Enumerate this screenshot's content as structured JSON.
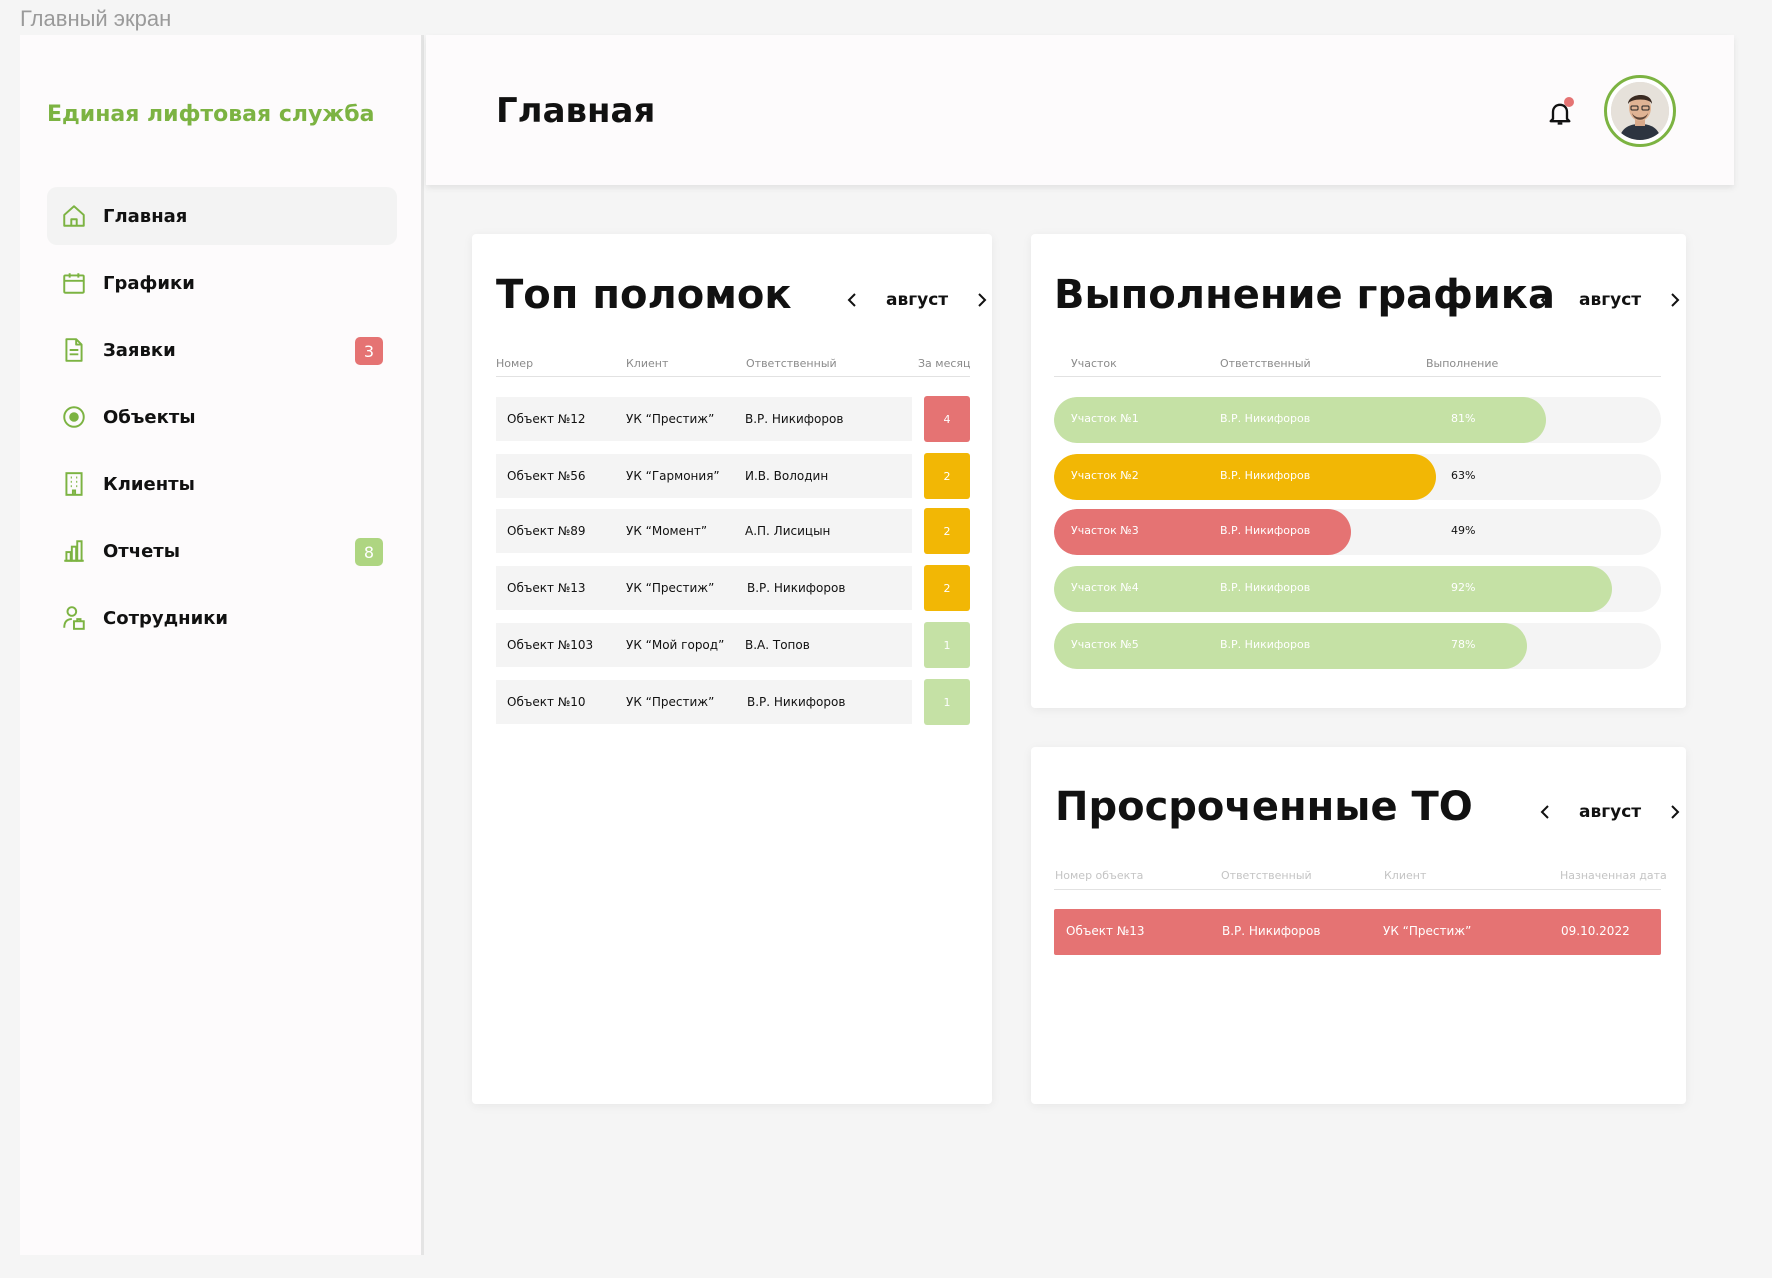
{
  "frame_label": "Главный экран",
  "brand": "Единая лифтовая служба",
  "nav": [
    {
      "label": "Главная",
      "icon": "home-icon",
      "active": true,
      "badge": ""
    },
    {
      "label": "Графики",
      "icon": "calendar-icon",
      "active": false,
      "badge": ""
    },
    {
      "label": "Заявки",
      "icon": "document-icon",
      "active": false,
      "badge": "3",
      "badge_color": "#e57373"
    },
    {
      "label": "Объекты",
      "icon": "target-icon",
      "active": false,
      "badge": ""
    },
    {
      "label": "Клиенты",
      "icon": "building-icon",
      "active": false,
      "badge": ""
    },
    {
      "label": "Отчеты",
      "icon": "bar-chart-icon",
      "active": false,
      "badge": "8",
      "badge_color": "#aed581"
    },
    {
      "label": "Сотрудники",
      "icon": "employee-icon",
      "active": false,
      "badge": ""
    }
  ],
  "header": {
    "title": "Главная"
  },
  "colors": {
    "green": "#7cb342",
    "light_green": "#c5e1a5",
    "yellow": "#f2b705",
    "red": "#e57373"
  },
  "breakdowns": {
    "title": "Топ поломок",
    "month": "август",
    "columns": [
      "Номер",
      "Клиент",
      "Ответственный",
      "За месяц"
    ],
    "rows": [
      {
        "number": "Объект №12",
        "client": "УК “Престиж”",
        "responsible": "В.Р. Никифоров",
        "count": "4",
        "level": "red"
      },
      {
        "number": "Объект №56",
        "client": "УК “Гармония”",
        "responsible": "И.В. Володин",
        "count": "2",
        "level": "yellow"
      },
      {
        "number": "Объект №89",
        "client": "УК “Момент”",
        "responsible": "А.П. Лисицын",
        "count": "2",
        "level": "yellow"
      },
      {
        "number": "Объект №13",
        "client": "УК “Престиж”",
        "responsible": "В.Р. Никифоров",
        "count": "2",
        "level": "yellow"
      },
      {
        "number": "Объект №103",
        "client": "УК “Мой город”",
        "responsible": "В.А. Топов",
        "count": "1",
        "level": "green"
      },
      {
        "number": "Объект №10",
        "client": "УК “Престиж”",
        "responsible": "В.Р. Никифоров",
        "count": "1",
        "level": "green"
      }
    ]
  },
  "schedule": {
    "title": "Выполнение графика",
    "month": "август",
    "columns": [
      "Участок",
      "Ответственный",
      "Выполнение"
    ],
    "rows": [
      {
        "area": "Участок №1",
        "responsible": "В.Р. Никифоров",
        "percent": "81%",
        "value": 81,
        "level": "green"
      },
      {
        "area": "Участок №2",
        "responsible": "В.Р. Никифоров",
        "percent": "63%",
        "value": 63,
        "level": "yellow"
      },
      {
        "area": "Участок №3",
        "responsible": "В.Р. Никифоров",
        "percent": "49%",
        "value": 49,
        "level": "red"
      },
      {
        "area": "Участок №4",
        "responsible": "В.Р. Никифоров",
        "percent": "92%",
        "value": 92,
        "level": "green"
      },
      {
        "area": "Участок №5",
        "responsible": "В.Р. Никифоров",
        "percent": "78%",
        "value": 78,
        "level": "green"
      }
    ]
  },
  "overdue": {
    "title": "Просроченные ТО",
    "month": "август",
    "columns": [
      "Номер объекта",
      "Ответственный",
      "Клиент",
      "Назначенная дата"
    ],
    "rows": [
      {
        "number": "Объект №13",
        "responsible": "В.Р. Никифоров",
        "client": "УК “Престиж”",
        "date": "09.10.2022"
      }
    ]
  }
}
